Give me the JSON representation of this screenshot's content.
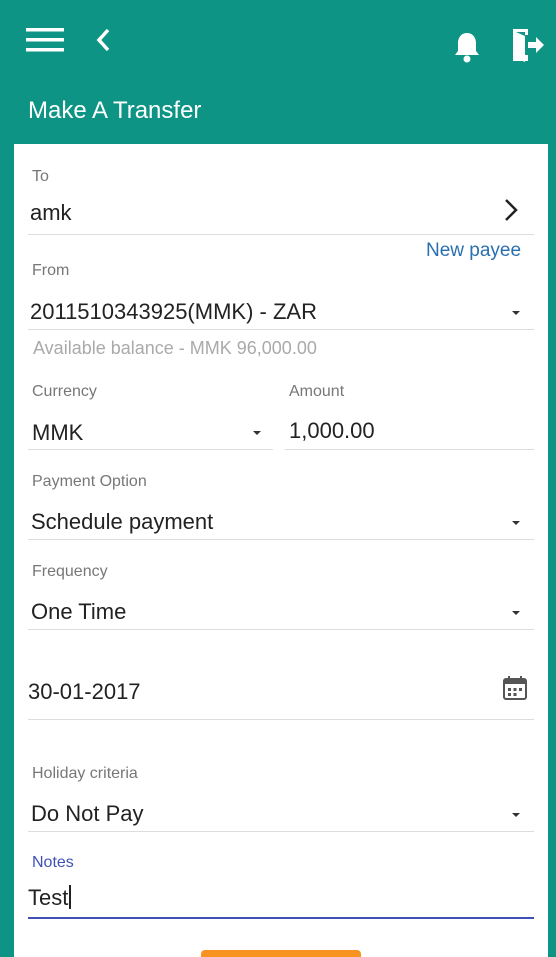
{
  "header": {
    "title": "Make A Transfer",
    "icons": {
      "menu": "menu-icon",
      "back": "chevron-left-icon",
      "notifications": "bell-icon",
      "logout": "logout-icon"
    }
  },
  "form": {
    "to": {
      "label": "To",
      "value": "amk"
    },
    "new_payee": "New payee",
    "from": {
      "label": "From",
      "value": "2011510343925(MMK) - ZAR",
      "balance_hint": "Available balance - MMK 96,000.00"
    },
    "currency": {
      "label": "Currency",
      "value": "MMK"
    },
    "amount": {
      "label": "Amount",
      "value": "1,000.00"
    },
    "payment_option": {
      "label": "Payment Option",
      "value": "Schedule payment"
    },
    "frequency": {
      "label": "Frequency",
      "value": "One Time"
    },
    "date": {
      "value": "30-01-2017"
    },
    "holiday_criteria": {
      "label": "Holiday criteria",
      "value": "Do Not Pay"
    },
    "notes": {
      "label": "Notes",
      "value": "Test"
    }
  },
  "colors": {
    "primary": "#0d9484",
    "link": "#2a6fb0",
    "focus": "#3f51b5",
    "button": "#f7931e"
  }
}
